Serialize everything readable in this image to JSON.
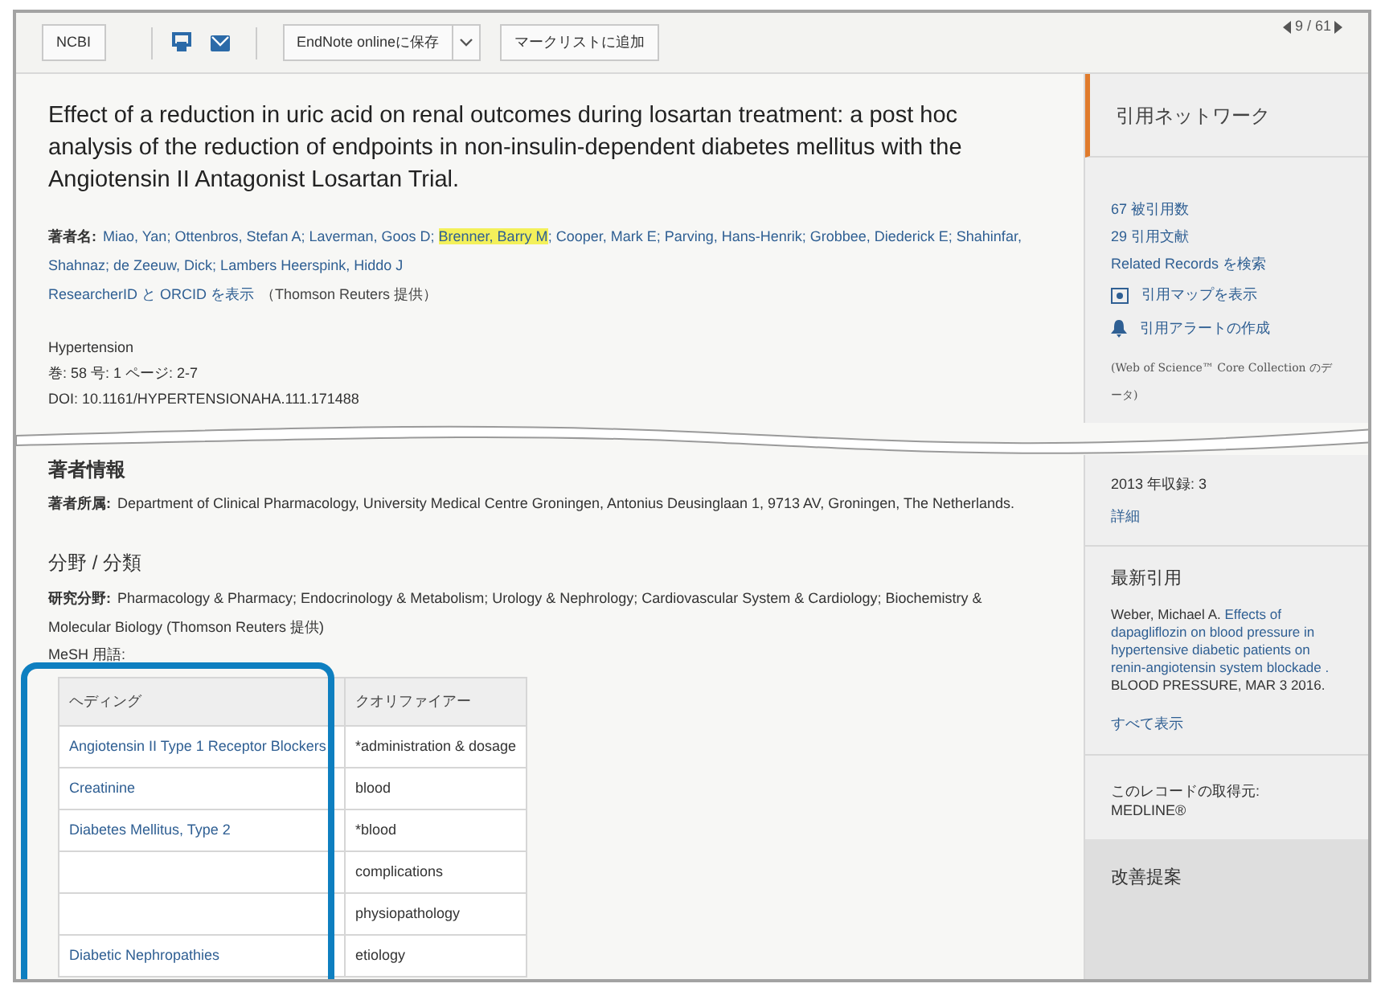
{
  "toolbar": {
    "ncbi": "NCBI",
    "save": "EndNote onlineに保存",
    "marklist": "マークリストに追加",
    "pager": "9 / 61"
  },
  "record": {
    "title": "Effect of a reduction in uric acid on renal outcomes during losartan treatment: a post hoc analysis of the reduction of endpoints in non-insulin-dependent diabetes mellitus with the Angiotensin II Antagonist Losartan Trial.",
    "authors_label": "著者名:",
    "authors": [
      {
        "text": "Miao, Yan; Ottenbros, Stefan A; Laverman, Goos D; ",
        "highlighted": false
      },
      {
        "text": "Brenner, Barry M",
        "highlighted": true
      },
      {
        "text": "; Cooper, Mark E; Parving, Hans-Henrik; Grobbee, Diederick E; Shahinfar, Shahnaz; de Zeeuw, Dick; Lambers Heerspink, Hiddo J",
        "highlighted": false
      }
    ],
    "researcher_link": "ResearcherID と ORCID を表示",
    "researcher_note": "（Thomson Reuters 提供）",
    "source": [
      "Hypertension",
      "巻: 58 号: 1 ページ: 2-7",
      "DOI: 10.1161/HYPERTENSIONAHA.111.171488"
    ],
    "author_info": {
      "heading": "著者情報",
      "label": "著者所属:",
      "text": "Department of Clinical Pharmacology, University Medical Centre Groningen, Antonius Deusinglaan 1, 9713 AV, Groningen, The Netherlands."
    },
    "categories": {
      "heading": "分野 / 分類",
      "label": "研究分野:",
      "text": "Pharmacology & Pharmacy; Endocrinology & Metabolism; Urology & Nephrology; Cardiovascular System & Cardiology; Biochemistry & Molecular Biology (Thomson Reuters 提供)",
      "mesh_label": "MeSH 用語:"
    },
    "mesh_table": {
      "columns": [
        "ヘディング",
        "クオリファイアー"
      ],
      "rows": [
        [
          "Angiotensin II Type 1 Receptor Blockers",
          "*administration & dosage"
        ],
        [
          "Creatinine",
          "blood"
        ],
        [
          "Diabetes Mellitus, Type 2",
          "*blood"
        ],
        [
          "",
          "complications"
        ],
        [
          "",
          "physiopathology"
        ],
        [
          "Diabetic Nephropathies",
          "etiology"
        ]
      ]
    }
  },
  "sidebar": {
    "network_heading": "引用ネットワーク",
    "network_links": [
      "67 被引用数",
      "29 引用文献",
      "Related Records を検索"
    ],
    "map_link": "引用マップを表示",
    "alert_link": "引用アラートの作成",
    "data_note": "(Web of Science™ Core Collection のデータ)",
    "year": "2013 年収録: 3",
    "details": "詳細",
    "latest_heading": "最新引用",
    "citation": {
      "author": "Weber, Michael A. ",
      "title": "Effects of dapagliflozin on blood pressure in hypertensive diabetic patients on renin-angiotensin system blockade .",
      "source": " BLOOD PRESSURE, MAR 3 2016."
    },
    "show_all": "すべて表示",
    "origin_label": "このレコードの取得元:",
    "origin": "MEDLINE®",
    "suggest_heading": "改善提案"
  }
}
